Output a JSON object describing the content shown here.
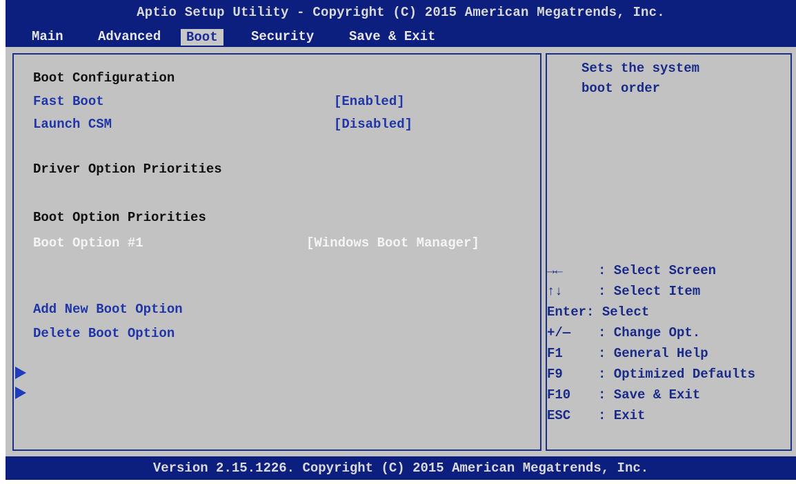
{
  "header": {
    "title": "Aptio Setup Utility - Copyright (C) 2015 American Megatrends, Inc."
  },
  "menu": {
    "items": [
      "Main",
      "Advanced",
      "Boot",
      "Security",
      "Save & Exit"
    ],
    "active": "Boot"
  },
  "boot": {
    "section_boot_config": "Boot Configuration",
    "fast_boot": {
      "label": "Fast Boot",
      "value": "[Enabled]"
    },
    "launch_csm": {
      "label": "Launch CSM",
      "value": "[Disabled]"
    },
    "section_driver_priorities": "Driver Option Priorities",
    "section_boot_priorities": "Boot Option Priorities",
    "boot_option_1": {
      "label": "Boot Option #1",
      "value": "[Windows Boot Manager]"
    },
    "add_new_boot_option": "Add New Boot Option",
    "delete_boot_option": "Delete Boot Option"
  },
  "help": {
    "description_line1": "Sets the system",
    "description_line2": "boot order"
  },
  "keys": [
    {
      "key": "→←",
      "action": ": Select Screen"
    },
    {
      "key": "↑↓",
      "action": ": Select Item"
    },
    {
      "key": "Enter:",
      "action": "Select"
    },
    {
      "key": "+/—",
      "action": ": Change Opt."
    },
    {
      "key": "F1",
      "action": ": General Help"
    },
    {
      "key": "F9",
      "action": ": Optimized Defaults"
    },
    {
      "key": "F10",
      "action": ": Save & Exit"
    },
    {
      "key": "ESC",
      "action": ": Exit"
    }
  ],
  "footer": {
    "text": "Version 2.15.1226. Copyright (C) 2015 American Megatrends, Inc."
  },
  "colors": {
    "header_bg": "#0c1f7e",
    "panel_bg": "#c2c2c2",
    "highlight_blue": "#1f35a8",
    "selected_white": "#f4f4f4"
  }
}
